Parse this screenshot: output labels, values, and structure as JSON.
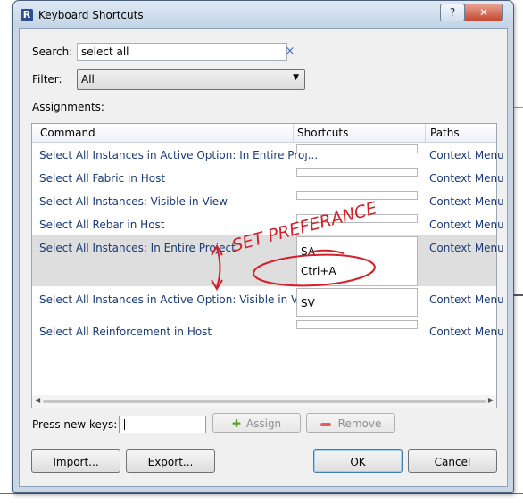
{
  "window": {
    "title": "Keyboard Shortcuts",
    "help_label": "?",
    "close_label": "✕",
    "app_icon": "R"
  },
  "search": {
    "label": "Search:",
    "value": "select all",
    "clear_label": "×"
  },
  "filter": {
    "label": "Filter:",
    "value": "All"
  },
  "assignments_label": "Assignments:",
  "grid": {
    "columns": [
      "Command",
      "Shortcuts",
      "Paths"
    ],
    "rows": [
      {
        "command": "Select All Instances in Active Option: In Entire Proj...",
        "shortcuts": [],
        "path": "Context Menu"
      },
      {
        "command": "Select All Fabric in Host",
        "shortcuts": [],
        "path": "Context Menu"
      },
      {
        "command": "Select All Instances: Visible in View",
        "shortcuts": [],
        "path": "Context Menu"
      },
      {
        "command": "Select All Rebar in Host",
        "shortcuts": [],
        "path": "Context Menu"
      },
      {
        "command": "Select All Instances: In Entire Project",
        "shortcuts": [
          "SA",
          "Ctrl+A"
        ],
        "path": "Context Menu"
      },
      {
        "command": "Select All Instances in Active Option: Visible in View",
        "shortcuts": [
          "SV"
        ],
        "path": "Context Menu"
      },
      {
        "command": "Select All Reinforcement in Host",
        "shortcuts": [],
        "path": "Context Menu"
      }
    ]
  },
  "press_keys": {
    "label": "Press new keys:",
    "value": ""
  },
  "buttons": {
    "assign": "Assign",
    "remove": "Remove",
    "import": "Import...",
    "export": "Export...",
    "ok": "OK",
    "cancel": "Cancel"
  },
  "annotation": {
    "text": "SET PREFERANCE",
    "color": "#d4202a"
  }
}
